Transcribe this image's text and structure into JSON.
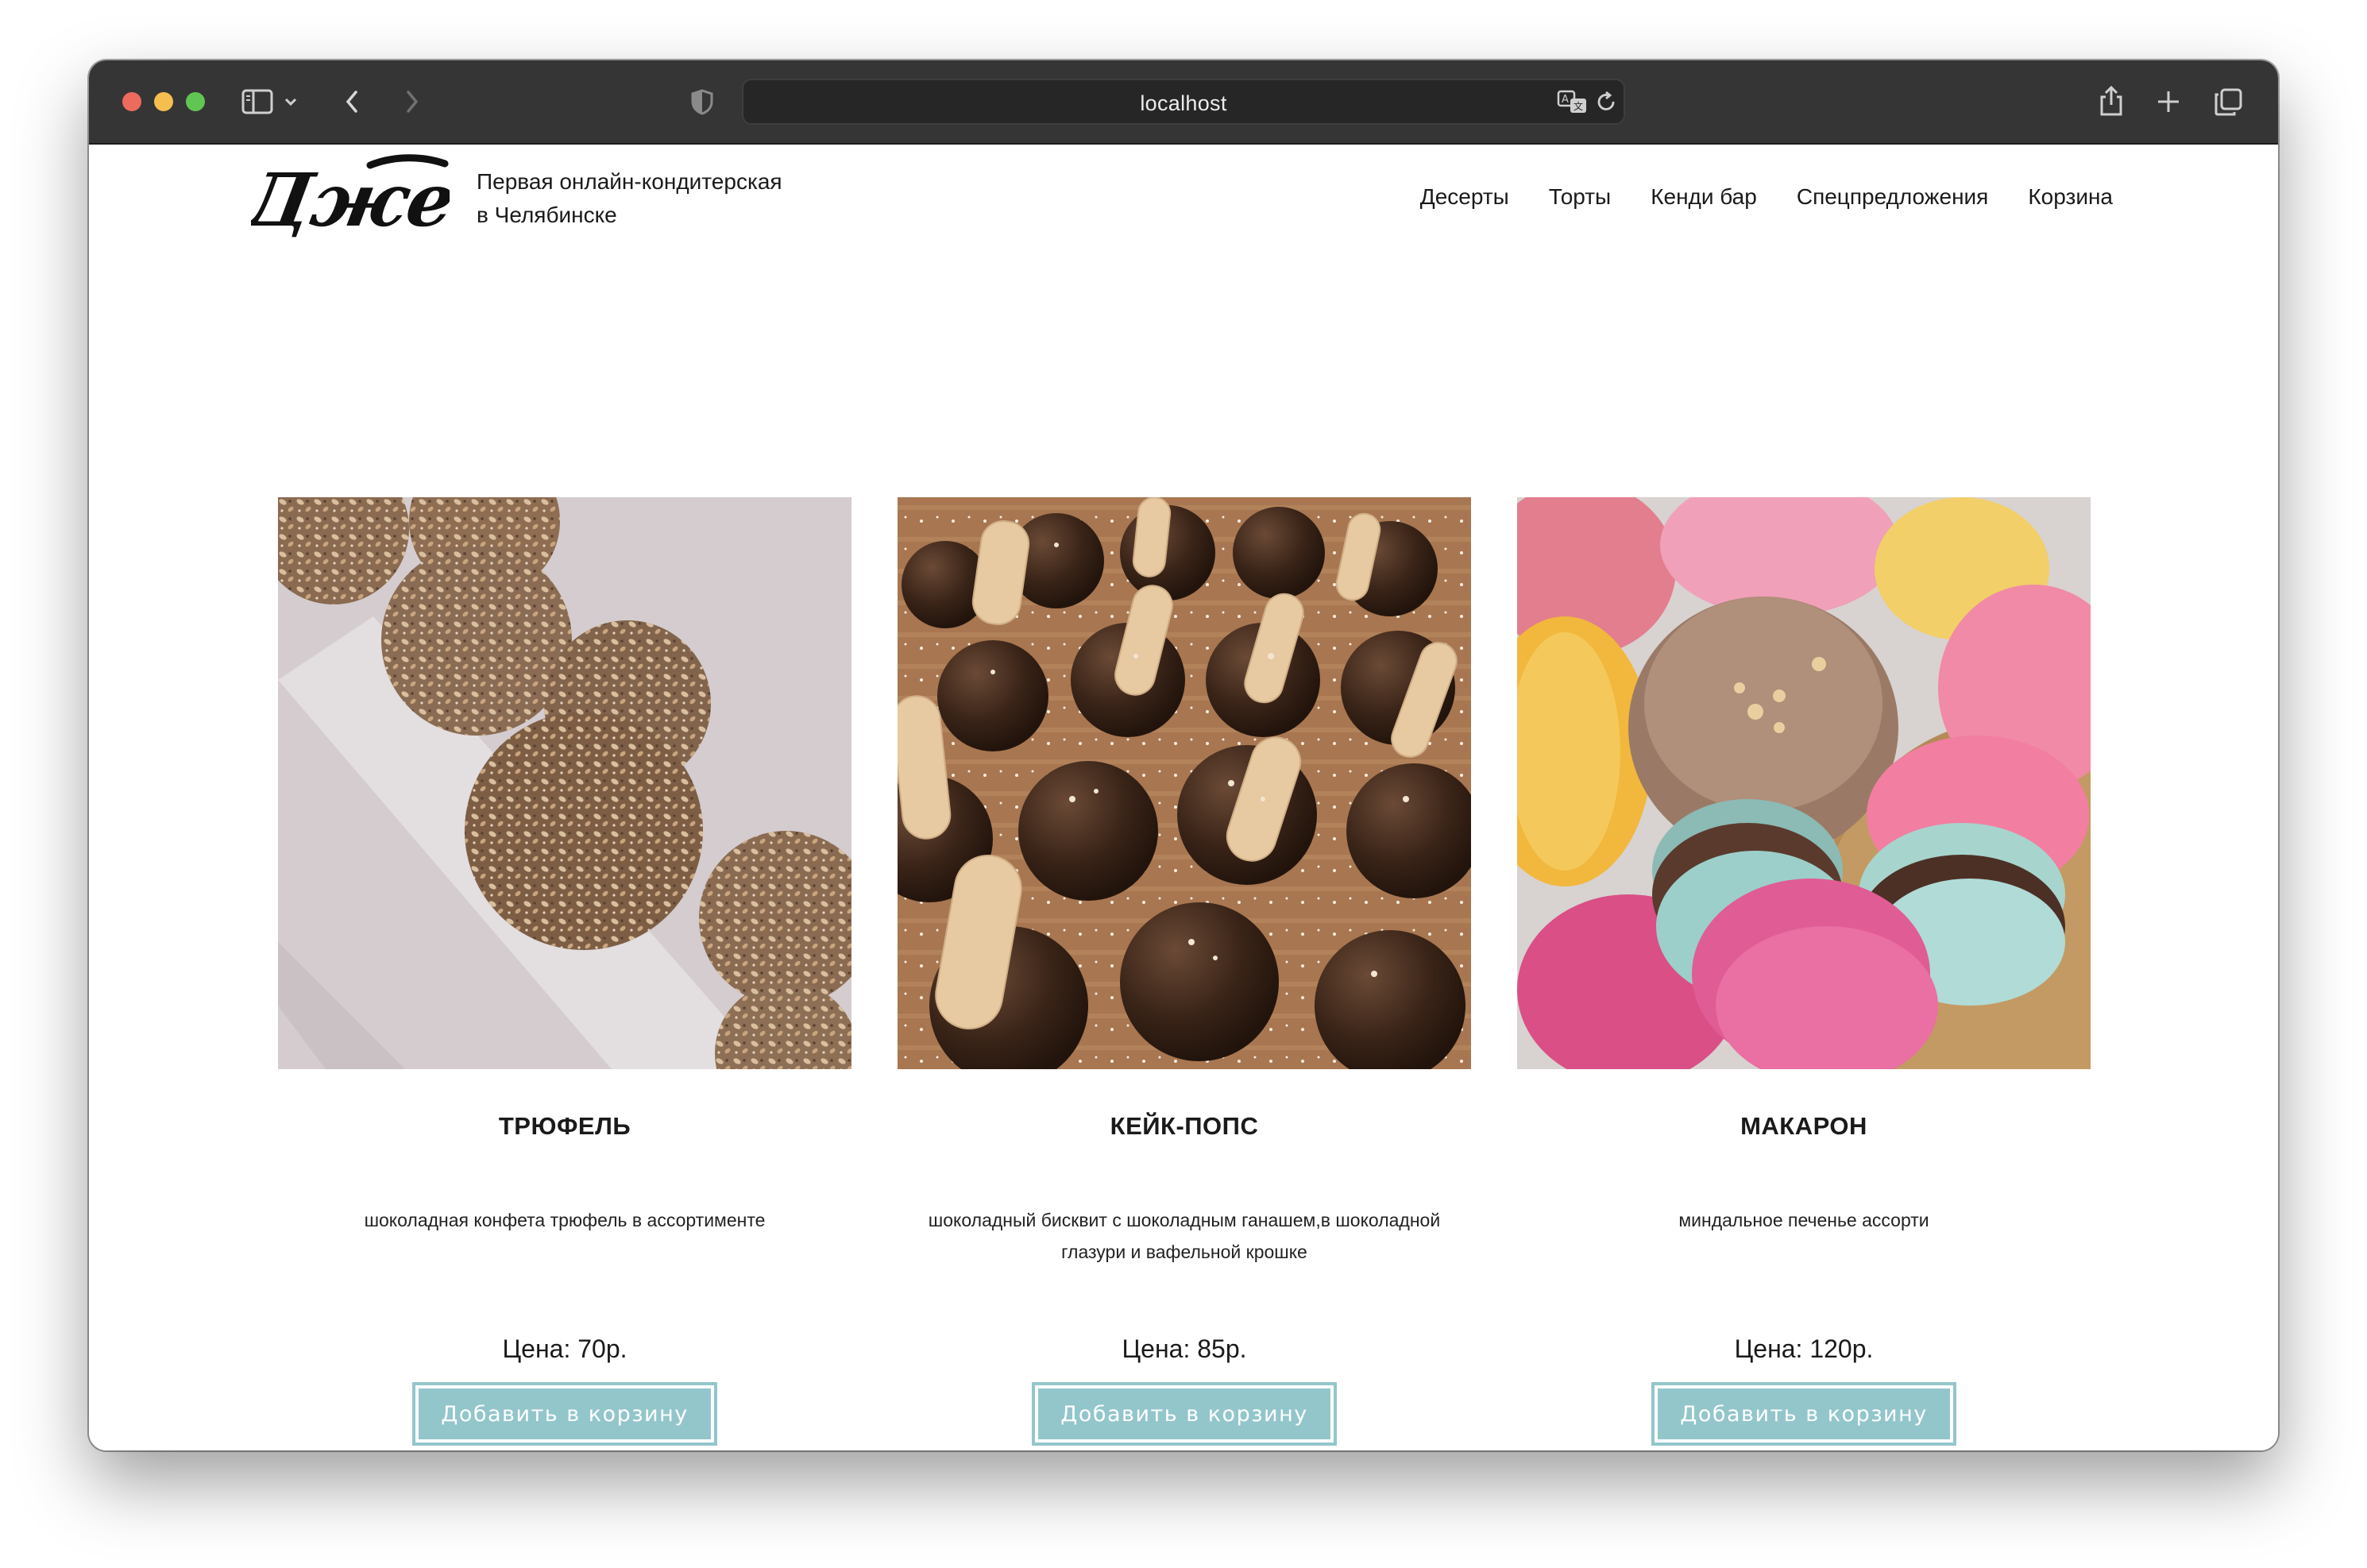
{
  "browser": {
    "url": "localhost",
    "icons": [
      "sidebar-icon",
      "chevron-down-icon",
      "back-icon",
      "forward-icon",
      "shield-icon",
      "translate-icon",
      "reload-icon",
      "share-icon",
      "new-tab-icon",
      "tabs-overview-icon"
    ]
  },
  "header": {
    "logo_text": "Джем",
    "tagline_line1": "Первая онлайн-кондитерская",
    "tagline_line2": "в Челябинске"
  },
  "nav": {
    "items": [
      {
        "label": "Десерты"
      },
      {
        "label": "Торты"
      },
      {
        "label": "Кенди бар"
      },
      {
        "label": "Спецпредложения"
      },
      {
        "label": "Корзина"
      }
    ]
  },
  "products": [
    {
      "title": "ТРЮФЕЛЬ",
      "description": "шоколадная конфета трюфель в ассортименте",
      "price": "Цена: 70р.",
      "button": "Добавить в корзину"
    },
    {
      "title": "КЕЙК-ПОПС",
      "description": "шоколадный бисквит с шоколадным ганашем,в шоколадной глазури и вафельной крошке",
      "price": "Цена: 85р.",
      "button": "Добавить в корзину"
    },
    {
      "title": "МАКАРОН",
      "description": "миндальное печенье ассорти",
      "price": "Цена: 120р.",
      "button": "Добавить в корзину"
    }
  ],
  "colors": {
    "accent_button": "#93c6cb",
    "toolbar": "#353535",
    "text": "#1a1a1a"
  }
}
